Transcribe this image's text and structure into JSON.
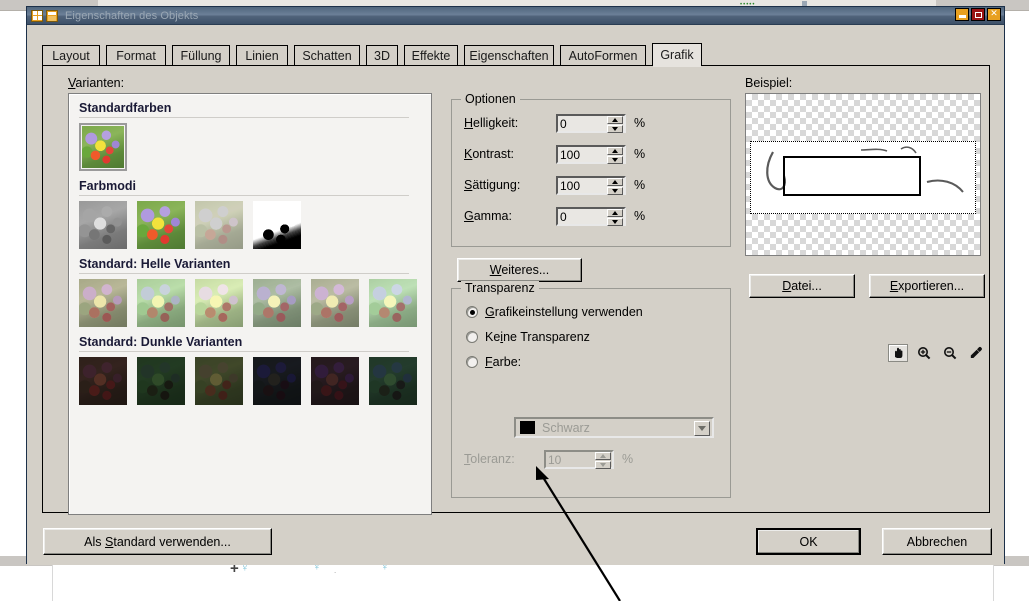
{
  "window": {
    "title": "Eigenschaften des Objekts",
    "icons": {
      "menu": "grid-icon",
      "restore": "window-icon"
    },
    "buttons": {
      "minimize": "minimize-icon",
      "maximize": "maximize-icon",
      "close": "close-icon"
    }
  },
  "tabs": [
    {
      "label": "Layout",
      "active": false
    },
    {
      "label": "Format",
      "active": false
    },
    {
      "label": "Füllung",
      "active": false
    },
    {
      "label": "Linien",
      "active": false
    },
    {
      "label": "Schatten",
      "active": false
    },
    {
      "label": "3D",
      "active": false
    },
    {
      "label": "Effekte",
      "active": false
    },
    {
      "label": "Eigenschaften",
      "active": false
    },
    {
      "label": "AutoFormen",
      "active": false
    },
    {
      "label": "Grafik",
      "active": true
    }
  ],
  "varianten": {
    "label": "Varianten:",
    "groups": [
      {
        "title": "Standardfarben",
        "count": 1
      },
      {
        "title": "Farbmodi",
        "count": 4
      },
      {
        "title": "Standard: Helle Varianten",
        "count": 6
      },
      {
        "title": "Standard: Dunkle Varianten",
        "count": 6
      }
    ],
    "light_colors": [
      "#e49aa0",
      "#96dca0",
      "#ece89a",
      "#a9a8e8",
      "#e0a0df",
      "#9adfe0"
    ],
    "dark_colors": [
      "#a03846",
      "#1f7a2e",
      "#8a8a22",
      "#2f2f86",
      "#7c2a80",
      "#1f7a78"
    ],
    "selected_index": 0
  },
  "optionen": {
    "title": "Optionen",
    "rows": [
      {
        "label": "Helligkeit:",
        "mnemonic": "H",
        "value": "0",
        "unit": "%"
      },
      {
        "label": "Kontrast:",
        "mnemonic": "K",
        "value": "100",
        "unit": "%"
      },
      {
        "label": "Sättigung:",
        "mnemonic": "S",
        "value": "100",
        "unit": "%"
      },
      {
        "label": "Gamma:",
        "mnemonic": "G",
        "value": "0",
        "unit": "%"
      }
    ],
    "more_button": "Weiteres..."
  },
  "transparenz": {
    "title": "Transparenz",
    "options": [
      {
        "label": "Grafikeinstellung verwenden",
        "selected": true
      },
      {
        "label": "Keine Transparenz",
        "selected": false
      },
      {
        "label": "Farbe:",
        "selected": false
      }
    ],
    "color_combo": {
      "value": "Schwarz",
      "swatch": "#000000",
      "enabled": false
    },
    "tolerance": {
      "label": "Toleranz:",
      "value": "10",
      "unit": "%",
      "enabled": false
    }
  },
  "beispiel": {
    "label": "Beispiel:",
    "tools": [
      {
        "name": "hand-icon",
        "active": true
      },
      {
        "name": "zoom-in-icon",
        "active": false
      },
      {
        "name": "zoom-out-icon",
        "active": false
      },
      {
        "name": "eyedropper-icon",
        "active": false
      }
    ],
    "buttons": {
      "file": "Datei...",
      "export": "Exportieren..."
    }
  },
  "footer": {
    "use_as_default": "Als Standard verwenden...",
    "ok": "OK",
    "cancel": "Abbrechen"
  },
  "colors": {
    "dialog_face": "#d4d0c8",
    "titlebar": "#50667d",
    "accent_orange": "#e8a020",
    "maximize_red": "#9b1414"
  }
}
